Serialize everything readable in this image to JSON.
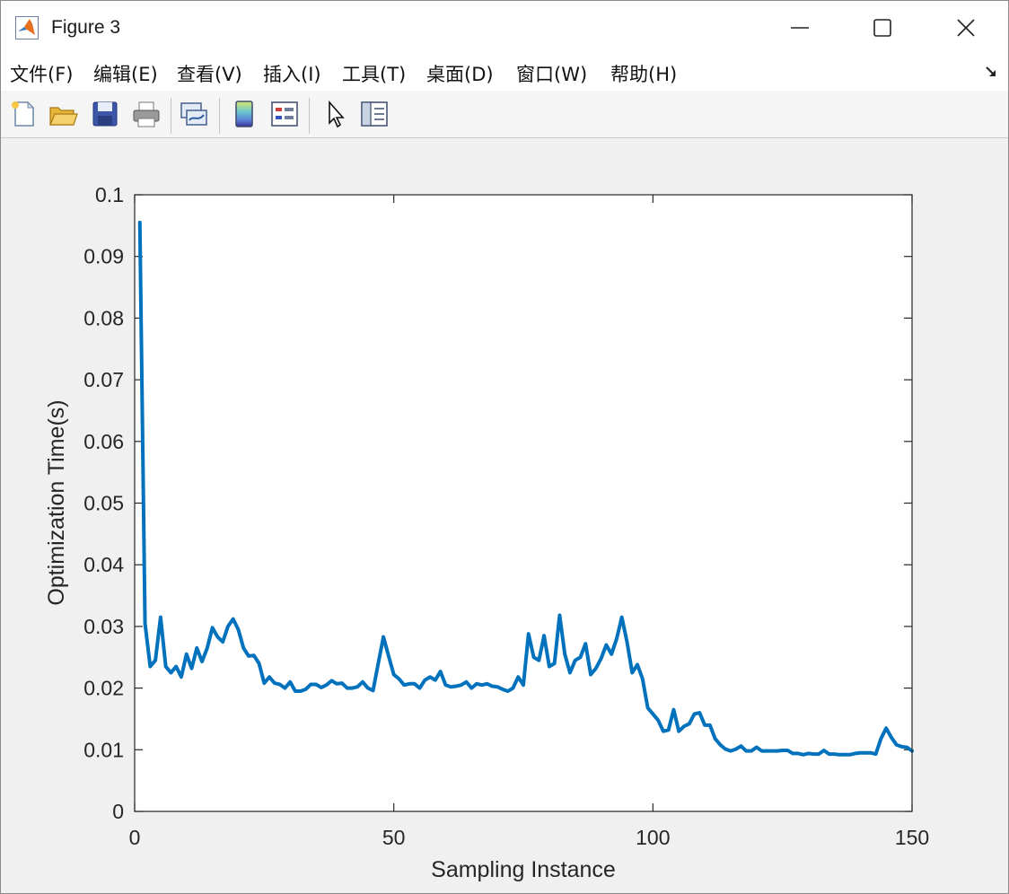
{
  "window": {
    "title": "Figure 3"
  },
  "menu": [
    {
      "label": "文件(F)"
    },
    {
      "label": "编辑(E)"
    },
    {
      "label": "查看(V)"
    },
    {
      "label": "插入(I)"
    },
    {
      "label": "工具(T)"
    },
    {
      "label": "桌面(D)"
    },
    {
      "label": "窗口(W)"
    },
    {
      "label": "帮助(H)"
    }
  ],
  "toolbar": {
    "icons": [
      "new-figure-icon",
      "open-file-icon",
      "save-icon",
      "print-icon",
      "link-plot-icon",
      "colorbar-icon",
      "legend-icon",
      "select-pointer-icon",
      "property-inspector-icon"
    ]
  },
  "colors": {
    "line": "#0072BD",
    "axes_bg": "#ffffff",
    "figure_bg": "#f0f0f0"
  },
  "chart_data": {
    "type": "line",
    "title": "",
    "xlabel": "Sampling Instance",
    "ylabel": "Optimization Time(s)",
    "xlim": [
      0,
      150
    ],
    "ylim": [
      0,
      0.1
    ],
    "xticks": [
      0,
      50,
      100,
      150
    ],
    "xtick_labels": [
      "0",
      "50",
      "100",
      "150"
    ],
    "yticks": [
      0,
      0.01,
      0.02,
      0.03,
      0.04,
      0.05,
      0.06,
      0.07,
      0.08,
      0.09,
      0.1
    ],
    "ytick_labels": [
      "0",
      "0.01",
      "0.02",
      "0.03",
      "0.04",
      "0.05",
      "0.06",
      "0.07",
      "0.08",
      "0.09",
      "0.1"
    ],
    "grid": false,
    "series": [
      {
        "x": [
          1,
          2,
          3,
          4,
          5,
          6,
          7,
          8,
          9,
          10,
          11,
          12,
          13,
          14,
          15,
          16,
          17,
          18,
          19,
          20,
          21,
          22,
          23,
          24,
          25,
          26,
          27,
          28,
          29,
          30,
          31,
          32,
          33,
          34,
          35,
          36,
          37,
          38,
          39,
          40,
          41,
          42,
          43,
          44,
          45,
          46,
          47,
          48,
          49,
          50,
          51,
          52,
          53,
          54,
          55,
          56,
          57,
          58,
          59,
          60,
          61,
          62,
          63,
          64,
          65,
          66,
          67,
          68,
          69,
          70,
          71,
          72,
          73,
          74,
          75,
          76,
          77,
          78,
          79,
          80,
          81,
          82,
          83,
          84,
          85,
          86,
          87,
          88,
          89,
          90,
          91,
          92,
          93,
          94,
          95,
          96,
          97,
          98,
          99,
          100,
          101,
          102,
          103,
          104,
          105,
          106,
          107,
          108,
          109,
          110,
          111,
          112,
          113,
          114,
          115,
          116,
          117,
          118,
          119,
          120,
          121,
          122,
          123,
          124,
          125,
          126,
          127,
          128,
          129,
          130,
          131,
          132,
          133,
          134,
          135,
          136,
          137,
          138,
          139,
          140,
          141,
          142,
          143,
          144,
          145,
          146,
          147,
          148,
          149,
          150
        ],
        "y": [
          0.0955,
          0.0305,
          0.0235,
          0.0245,
          0.0315,
          0.0235,
          0.0225,
          0.0235,
          0.0218,
          0.0255,
          0.0232,
          0.0265,
          0.0243,
          0.0265,
          0.0298,
          0.0283,
          0.0275,
          0.03,
          0.0312,
          0.0295,
          0.0265,
          0.0252,
          0.0253,
          0.024,
          0.0208,
          0.0218,
          0.0208,
          0.0206,
          0.02,
          0.021,
          0.0195,
          0.0195,
          0.0198,
          0.0206,
          0.0206,
          0.0201,
          0.0205,
          0.0212,
          0.0207,
          0.0208,
          0.02,
          0.02,
          0.0202,
          0.021,
          0.02,
          0.0196,
          0.024,
          0.0283,
          0.0252,
          0.0222,
          0.0215,
          0.0205,
          0.0207,
          0.0207,
          0.02,
          0.0213,
          0.0218,
          0.0213,
          0.0227,
          0.0205,
          0.0202,
          0.0203,
          0.0205,
          0.021,
          0.02,
          0.0207,
          0.0205,
          0.0207,
          0.0203,
          0.0202,
          0.0198,
          0.0195,
          0.02,
          0.0218,
          0.0205,
          0.0288,
          0.025,
          0.0245,
          0.0285,
          0.0235,
          0.024,
          0.0318,
          0.0255,
          0.0225,
          0.0245,
          0.025,
          0.0272,
          0.0222,
          0.0232,
          0.0248,
          0.027,
          0.0255,
          0.028,
          0.0315,
          0.0275,
          0.0225,
          0.0238,
          0.0215,
          0.0168,
          0.0158,
          0.0148,
          0.013,
          0.0132,
          0.0165,
          0.013,
          0.0138,
          0.0142,
          0.0158,
          0.016,
          0.014,
          0.014,
          0.0118,
          0.0108,
          0.0101,
          0.0098,
          0.0101,
          0.0106,
          0.0098,
          0.0098,
          0.0104,
          0.0098,
          0.0098,
          0.0098,
          0.0098,
          0.0099,
          0.0099,
          0.0094,
          0.0094,
          0.0092,
          0.0094,
          0.0093,
          0.0093,
          0.0099,
          0.0093,
          0.0093,
          0.0092,
          0.0092,
          0.0092,
          0.0094,
          0.0095,
          0.0095,
          0.0095,
          0.0093,
          0.0118,
          0.0135,
          0.012,
          0.0108,
          0.0105,
          0.0104,
          0.0098
        ]
      }
    ]
  }
}
